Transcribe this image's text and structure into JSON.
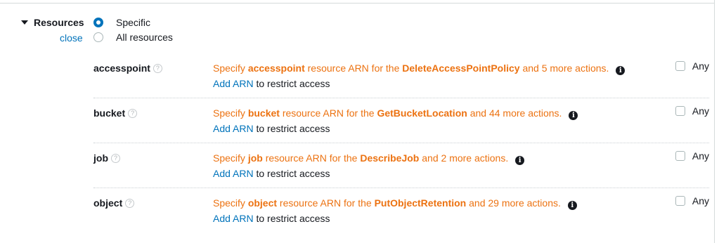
{
  "section": {
    "title": "Resources",
    "close_label": "close",
    "options": [
      {
        "label": "Specific",
        "selected": true
      },
      {
        "label": "All resources",
        "selected": false
      }
    ]
  },
  "resources": [
    {
      "name": "accesspoint",
      "prefix": "Specify ",
      "type": "accesspoint",
      "middle": " resource ARN for the ",
      "action": "DeleteAccessPointPolicy",
      "suffix": " and 5 more actions.",
      "add_link": "Add ARN",
      "add_rest": " to restrict access",
      "any_label": "Any",
      "any_checked": false
    },
    {
      "name": "bucket",
      "prefix": "Specify ",
      "type": "bucket",
      "middle": " resource ARN for the ",
      "action": "GetBucketLocation",
      "suffix": " and 44 more actions.",
      "add_link": "Add ARN",
      "add_rest": " to restrict access",
      "any_label": "Any",
      "any_checked": false
    },
    {
      "name": "job",
      "prefix": "Specify ",
      "type": "job",
      "middle": " resource ARN for the ",
      "action": "DescribeJob",
      "suffix": " and 2 more actions.",
      "add_link": "Add ARN",
      "add_rest": " to restrict access",
      "any_label": "Any",
      "any_checked": false
    },
    {
      "name": "object",
      "prefix": "Specify ",
      "type": "object",
      "middle": " resource ARN for the ",
      "action": "PutObjectRetention",
      "suffix": " and 29 more actions.",
      "add_link": "Add ARN",
      "add_rest": " to restrict access",
      "any_label": "Any",
      "any_checked": false
    }
  ],
  "icons": {
    "help": "question-mark-icon",
    "info": "info-icon",
    "caret": "caret-down-icon"
  },
  "colors": {
    "link": "#0073bb",
    "warning": "#ec7211",
    "text": "#16191f"
  }
}
